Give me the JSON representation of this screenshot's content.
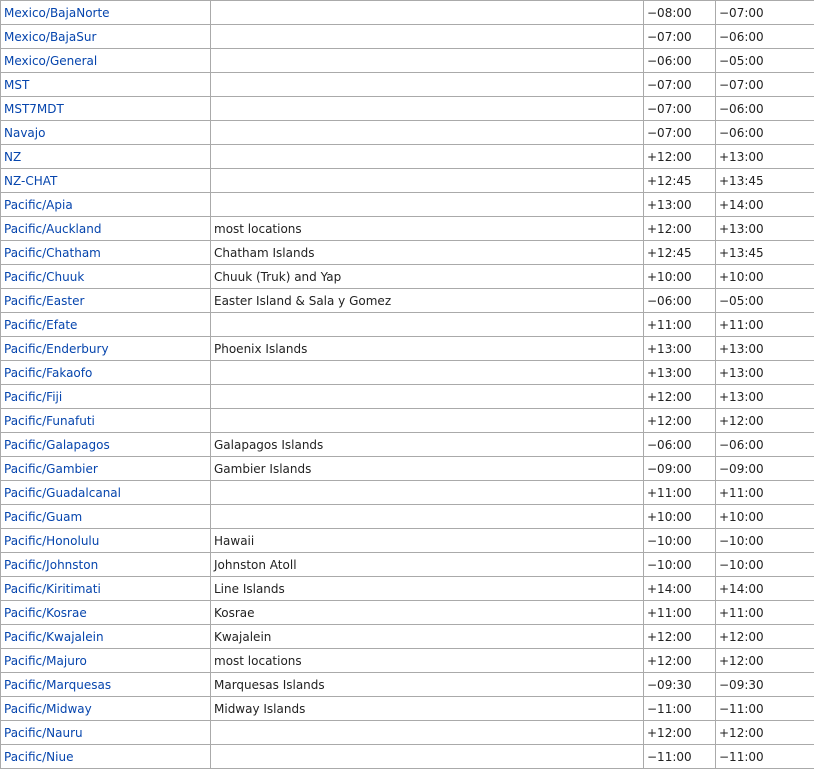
{
  "rows": [
    {
      "tz": "Mexico/BajaNorte",
      "comment": "",
      "utc": "−08:00",
      "dst": "−07:00"
    },
    {
      "tz": "Mexico/BajaSur",
      "comment": "",
      "utc": "−07:00",
      "dst": "−06:00"
    },
    {
      "tz": "Mexico/General",
      "comment": "",
      "utc": "−06:00",
      "dst": "−05:00"
    },
    {
      "tz": "MST",
      "comment": "",
      "utc": "−07:00",
      "dst": "−07:00"
    },
    {
      "tz": "MST7MDT",
      "comment": "",
      "utc": "−07:00",
      "dst": "−06:00"
    },
    {
      "tz": "Navajo",
      "comment": "",
      "utc": "−07:00",
      "dst": "−06:00"
    },
    {
      "tz": "NZ",
      "comment": "",
      "utc": "+12:00",
      "dst": "+13:00"
    },
    {
      "tz": "NZ-CHAT",
      "comment": "",
      "utc": "+12:45",
      "dst": "+13:45"
    },
    {
      "tz": "Pacific/Apia",
      "comment": "",
      "utc": "+13:00",
      "dst": "+14:00"
    },
    {
      "tz": "Pacific/Auckland",
      "comment": "most locations",
      "utc": "+12:00",
      "dst": "+13:00"
    },
    {
      "tz": "Pacific/Chatham",
      "comment": "Chatham Islands",
      "utc": "+12:45",
      "dst": "+13:45"
    },
    {
      "tz": "Pacific/Chuuk",
      "comment": "Chuuk (Truk) and Yap",
      "utc": "+10:00",
      "dst": "+10:00"
    },
    {
      "tz": "Pacific/Easter",
      "comment": "Easter Island & Sala y Gomez",
      "utc": "−06:00",
      "dst": "−05:00"
    },
    {
      "tz": "Pacific/Efate",
      "comment": "",
      "utc": "+11:00",
      "dst": "+11:00"
    },
    {
      "tz": "Pacific/Enderbury",
      "comment": "Phoenix Islands",
      "utc": "+13:00",
      "dst": "+13:00"
    },
    {
      "tz": "Pacific/Fakaofo",
      "comment": "",
      "utc": "+13:00",
      "dst": "+13:00"
    },
    {
      "tz": "Pacific/Fiji",
      "comment": "",
      "utc": "+12:00",
      "dst": "+13:00"
    },
    {
      "tz": "Pacific/Funafuti",
      "comment": "",
      "utc": "+12:00",
      "dst": "+12:00"
    },
    {
      "tz": "Pacific/Galapagos",
      "comment": "Galapagos Islands",
      "utc": "−06:00",
      "dst": "−06:00"
    },
    {
      "tz": "Pacific/Gambier",
      "comment": "Gambier Islands",
      "utc": "−09:00",
      "dst": "−09:00"
    },
    {
      "tz": "Pacific/Guadalcanal",
      "comment": "",
      "utc": "+11:00",
      "dst": "+11:00"
    },
    {
      "tz": "Pacific/Guam",
      "comment": "",
      "utc": "+10:00",
      "dst": "+10:00"
    },
    {
      "tz": "Pacific/Honolulu",
      "comment": "Hawaii",
      "utc": "−10:00",
      "dst": "−10:00"
    },
    {
      "tz": "Pacific/Johnston",
      "comment": "Johnston Atoll",
      "utc": "−10:00",
      "dst": "−10:00"
    },
    {
      "tz": "Pacific/Kiritimati",
      "comment": "Line Islands",
      "utc": "+14:00",
      "dst": "+14:00"
    },
    {
      "tz": "Pacific/Kosrae",
      "comment": "Kosrae",
      "utc": "+11:00",
      "dst": "+11:00"
    },
    {
      "tz": "Pacific/Kwajalein",
      "comment": "Kwajalein",
      "utc": "+12:00",
      "dst": "+12:00"
    },
    {
      "tz": "Pacific/Majuro",
      "comment": "most locations",
      "utc": "+12:00",
      "dst": "+12:00"
    },
    {
      "tz": "Pacific/Marquesas",
      "comment": "Marquesas Islands",
      "utc": "−09:30",
      "dst": "−09:30"
    },
    {
      "tz": "Pacific/Midway",
      "comment": "Midway Islands",
      "utc": "−11:00",
      "dst": "−11:00"
    },
    {
      "tz": "Pacific/Nauru",
      "comment": "",
      "utc": "+12:00",
      "dst": "+12:00"
    },
    {
      "tz": "Pacific/Niue",
      "comment": "",
      "utc": "−11:00",
      "dst": "−11:00"
    }
  ]
}
